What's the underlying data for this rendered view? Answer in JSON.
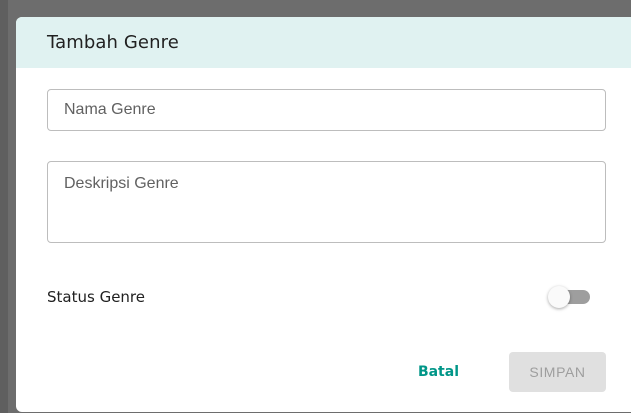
{
  "dialog": {
    "title": "Tambah Genre",
    "colors": {
      "header_bg": "#e0f2f1",
      "accent": "#009688",
      "disabled_bg": "#e0e0e0",
      "disabled_text": "#9e9e9e"
    }
  },
  "form": {
    "name_field": {
      "placeholder": "Nama Genre",
      "value": ""
    },
    "description_field": {
      "placeholder": "Deskripsi Genre",
      "value": ""
    },
    "status": {
      "label": "Status Genre",
      "enabled": false
    }
  },
  "actions": {
    "cancel_label": "Batal",
    "save_label": "SIMPAN",
    "save_disabled": true
  }
}
